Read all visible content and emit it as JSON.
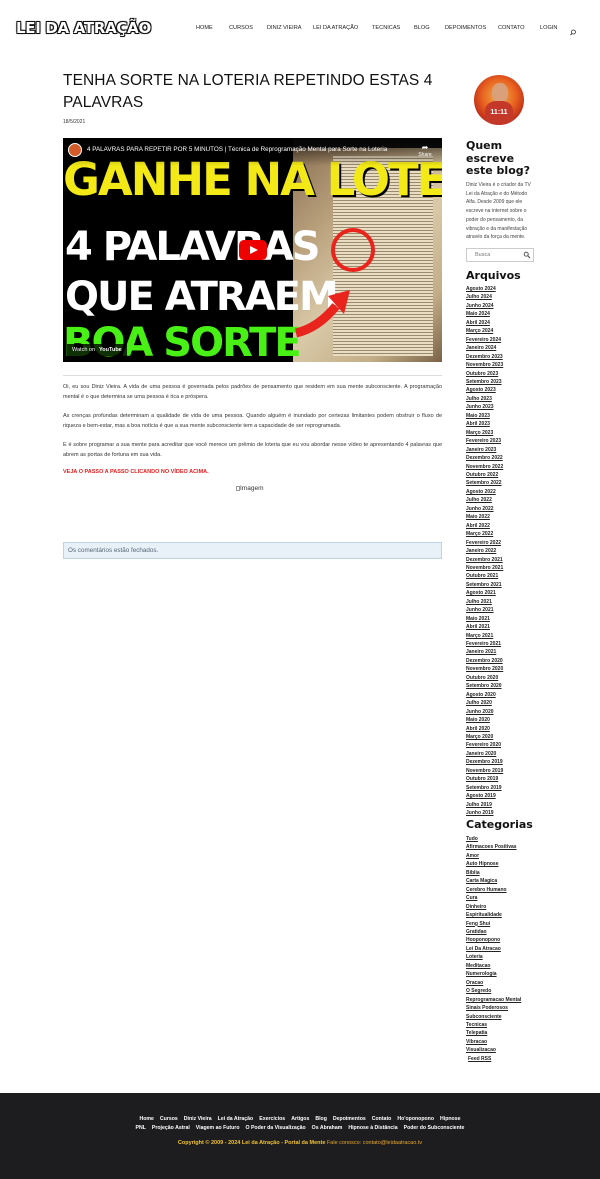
{
  "site": {
    "logo": "LEI DA ATRAÇÃO"
  },
  "nav": {
    "items": [
      "Home",
      "Cursos",
      "Diniz Vieira",
      "Lei da Atração",
      "Tecnicas",
      "Blog",
      "Depoimentos",
      "Contato",
      "Login"
    ]
  },
  "post": {
    "title": "TENHA SORTE NA LOTERIA REPETINDO ESTAS 4 PALAVRAS",
    "date": "18/5/2021",
    "video": {
      "title": "4 PALAVRAS PARA REPETIR POR 5 MINUTOS | Técnica de Reprogramação Mental para Sorte na Loteria",
      "share": "Share",
      "watch_on": "Watch on",
      "youtube": "YouTube",
      "thumb_line1": "GANHE NA LOTERIA",
      "thumb_line2": "4 PALAVRAS",
      "thumb_line3": "QUE ATRAEM",
      "thumb_line4": "BOA SORTE"
    },
    "paragraphs": [
      "Oi, eu sou Diniz Vieira. A vida de uma pessoa é governada pelos padrões de pensamento que residem em sua mente subconsciente. A programação mental é o que determina se uma pessoa é rica e próspera.",
      "As crenças profundas determinam a qualidade de vida de uma pessoa. Quando alguém é inundado por certezas limitantes podem obstruir o fluxo de riqueza e bem-estar, mas a boa notícia é que a sua mente subconsciente tem a capacidade de ser reprogramada.",
      "E é sobre programar a sua mente para acreditar que você merece um prêmio de loteria que eu vou abordar nesse vídeo te apresentando 4 palavras que abrem as portas de fortuna em sua vida."
    ],
    "cta": "VEJA O PASSO A PASSO CLICANDO NO VÍDEO ACIMA.",
    "image_alt": "Imagem",
    "comments_closed": "Os comentários estão fechados."
  },
  "sidebar": {
    "avatar_label": "11:11",
    "about_heading": "Quem escreve este blog?",
    "about_text": "Diniz Vieira é o criador da TV Lei da Atração e do Método Alfa. Desde 2009 que ele escreve na internet sobre o poder do pensamento, da vibração e da manifestação através da força da mente.",
    "search_placeholder": "Busca",
    "archive_heading": "Arquivos",
    "archives": [
      "Agosto 2024",
      "Julho 2024",
      "Junho 2024",
      "Maio 2024",
      "Abril 2024",
      "Março 2024",
      "Fevereiro 2024",
      "Janeiro 2024",
      "Dezembro 2023",
      "Novembro 2023",
      "Outubro 2023",
      "Setembro 2023",
      "Agosto 2023",
      "Julho 2023",
      "Junho 2023",
      "Maio 2023",
      "Abril 2023",
      "Março 2023",
      "Fevereiro 2023",
      "Janeiro 2023",
      "Dezembro 2022",
      "Novembro 2022",
      "Outubro 2022",
      "Setembro 2022",
      "Agosto 2022",
      "Julho 2022",
      "Junho 2022",
      "Maio 2022",
      "Abril 2022",
      "Março 2022",
      "Fevereiro 2022",
      "Janeiro 2022",
      "Dezembro 2021",
      "Novembro 2021",
      "Outubro 2021",
      "Setembro 2021",
      "Agosto 2021",
      "Julho 2021",
      "Junho 2021",
      "Maio 2021",
      "Abril 2021",
      "Março 2021",
      "Fevereiro 2021",
      "Janeiro 2021",
      "Dezembro 2020",
      "Novembro 2020",
      "Outubro 2020",
      "Setembro 2020",
      "Agosto 2020",
      "Julho 2020",
      "Junho 2020",
      "Maio 2020",
      "Abril 2020",
      "Março 2020",
      "Fevereiro 2020",
      "Janeiro 2020",
      "Dezembro 2019",
      "Novembro 2019",
      "Outubro 2019",
      "Setembro 2019",
      "Agosto 2019",
      "Julho 2019",
      "Junho 2019"
    ],
    "category_heading": "Categorias",
    "categories": [
      "Tudo",
      "Afirmacoes Positivas",
      "Amor",
      "Auto Hipnose",
      "Biblia",
      "Carta Magica",
      "Cerebro Humano",
      "Cura",
      "Dinheiro",
      "Espiritualidade",
      "Feng Shui",
      "Gratidao",
      "Hooponopono",
      "Lei Da Atracao",
      "Loteria",
      "Meditacao",
      "Numerologia",
      "Oracao",
      "O Segredo",
      "Reprogramacao Mental",
      "Sinais Poderosos",
      "Subconsciente",
      "Tecnicas",
      "Telepatia",
      "Vibracao",
      "Visualizacao"
    ],
    "feed": "Feed RSS"
  },
  "footer": {
    "links_row1": [
      "Home",
      "Cursos",
      "Diniz Vieira",
      "Lei da Atração",
      "Exercícios",
      "Artigos",
      "Blog",
      "Depoimentos",
      "Contato",
      "Ho'oponopono",
      "Hipnose"
    ],
    "links_row2": [
      "PNL",
      "Projeção Astral",
      "Viagem ao Futuro",
      "O Poder da Visualização",
      "Os Abraham",
      "Hipnose à Distância",
      "Poder do Subconsciente"
    ],
    "copyright": "Copyright © 2009 - 2024 Lei da Atração - Portal da Mente",
    "contact": "Fale conosco: contato@leidaatracao.tv"
  }
}
